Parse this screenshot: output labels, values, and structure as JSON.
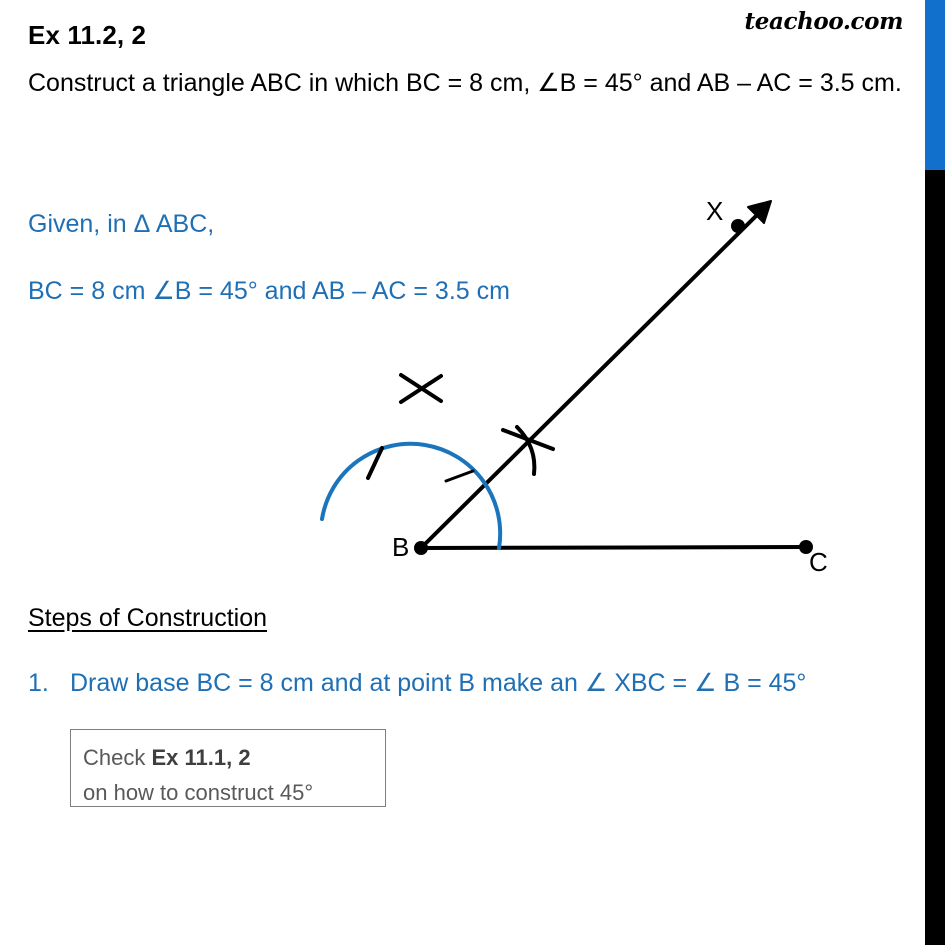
{
  "watermark": "teachoo.com",
  "header": {
    "exercise_title": "Ex 11.2, 2",
    "question": "Construct a triangle ABC in which BC = 8 cm, ∠B = 45°  and AB – AC = 3.5 cm."
  },
  "given": {
    "line_1": "Given, in Δ ABC,",
    "line_2": "BC = 8 cm ∠B = 45° and AB – AC = 3.5 cm"
  },
  "diagram": {
    "labels": {
      "point_b": "B",
      "point_c": "C",
      "point_x": "X"
    },
    "colors": {
      "arc": "#1a75bc",
      "line": "#000000"
    },
    "description": "Ray BX drawn at 45 degrees from base BC at point B, with compass construction arcs and cross marks"
  },
  "steps": {
    "heading": "Steps of Construction",
    "items": [
      {
        "number": "1.",
        "text": "Draw base BC  = 8 cm and at point B make an ∠ XBC = ∠ B = 45°"
      }
    ]
  },
  "note_box": {
    "line_1_prefix": "Check ",
    "line_1_strong": "Ex 11.1, 2",
    "line_2": "on how to construct 45°"
  },
  "colors": {
    "accent_blue": "#1f6fb5",
    "edge_bar_blue": "#1170cc",
    "edge_bar_black": "#000000",
    "note_text_gray": "#595959"
  }
}
